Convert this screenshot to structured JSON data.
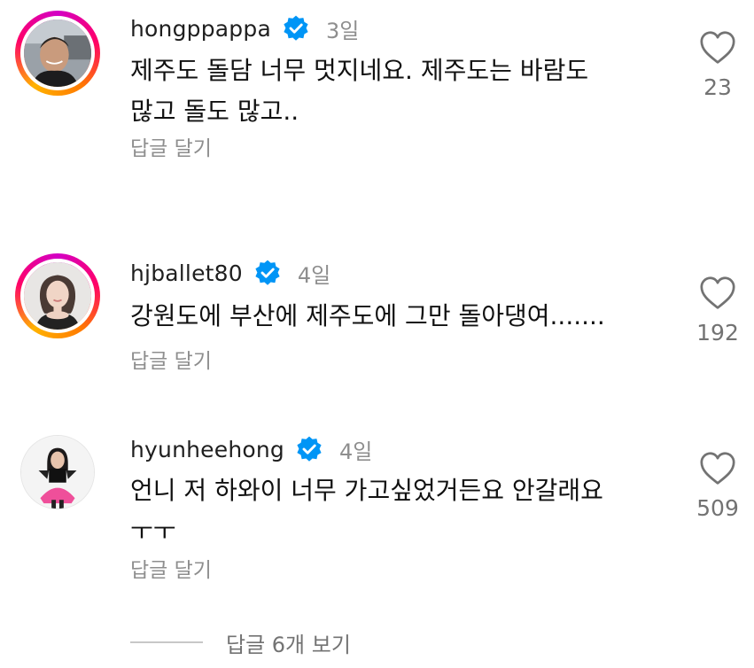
{
  "comments": [
    {
      "username": "hongppappa",
      "time": "3일",
      "text": "제주도 돌담 너무 멋지네요. 제주도는 바람도\n많고 돌도 많고..",
      "reply_label": "답글 달기",
      "likes": "23",
      "avatar_story_ring": true
    },
    {
      "username": "hjballet80",
      "time": "4일",
      "text": "강원도에 부산에 제주도에 그만 돌아댕여.......",
      "reply_label": "답글 달기",
      "likes": "192",
      "avatar_story_ring": true
    },
    {
      "username": "hyunheehong",
      "time": "4일",
      "text": "언니 저 하와이 너무 가고싶었거든요 안갈래요\nㅜㅜ",
      "reply_label": "답글 달기",
      "likes": "509",
      "avatar_story_ring": false
    }
  ],
  "view_replies": {
    "label": "답글 6개 보기"
  },
  "colors": {
    "verified_badge": "#0095f6",
    "secondary_text": "#8e8e8e",
    "story_ring_start": "#d300c5",
    "story_ring_end": "#ffb300"
  },
  "icons": {
    "like": "heart-outline-icon",
    "verified": "verified-badge-icon"
  }
}
